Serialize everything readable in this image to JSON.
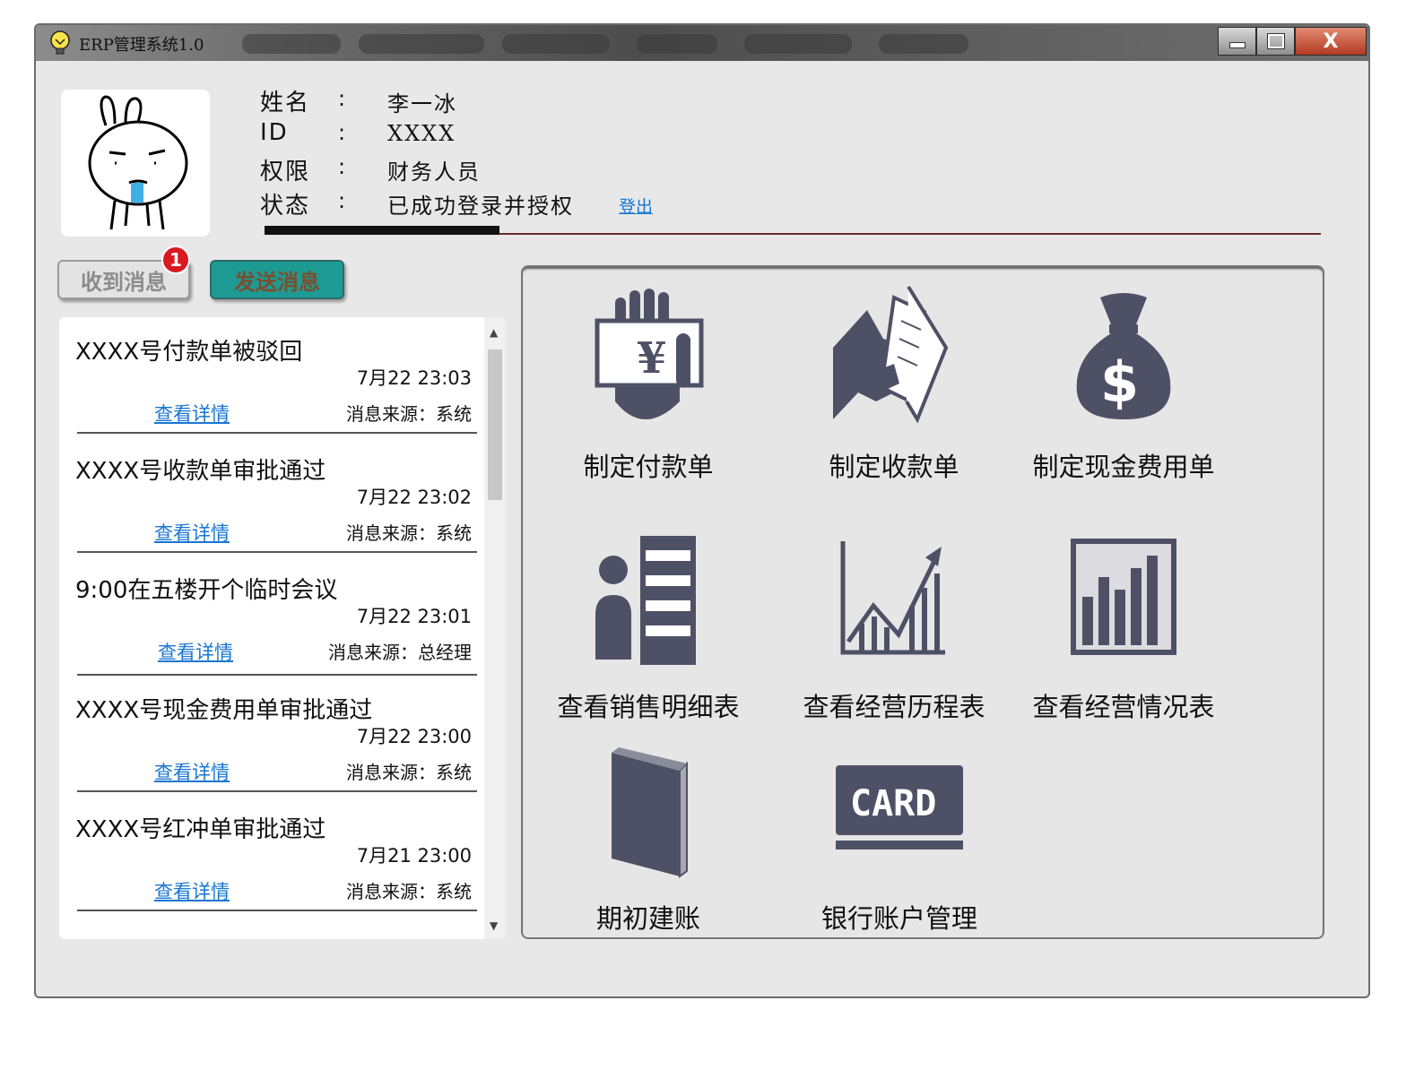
{
  "window": {
    "title": "ERP管理系统1.0",
    "close_label": "X"
  },
  "user": {
    "name_label": "姓名",
    "name": "李一冰",
    "id_label": "ID",
    "id": "XXXX",
    "role_label": "权限",
    "role": "财务人员",
    "status_label": "状态",
    "status": "已成功登录并授权",
    "logout": "登出",
    "colon": ":"
  },
  "buttons": {
    "received": "收到消息",
    "received_badge": "1",
    "send": "发送消息"
  },
  "messages": [
    {
      "title": "XXXX号付款单被驳回",
      "time": "7月22 23:03",
      "link": "查看详情",
      "source": "消息来源：系统"
    },
    {
      "title": "XXXX号收款单审批通过",
      "time": "7月22 23:02",
      "link": "查看详情",
      "source": "消息来源：系统"
    },
    {
      "title": "9:00在五楼开个临时会议",
      "time": "7月22 23:01",
      "link": "查看详情",
      "source": "消息来源：总经理"
    },
    {
      "title": "XXXX号现金费用单审批通过",
      "time": "7月22 23:00",
      "link": "查看详情",
      "source": "消息来源：系统"
    },
    {
      "title": "XXXX号红冲单审批通过",
      "time": "7月21 23:00",
      "link": "查看详情",
      "source": "消息来源：系统"
    }
  ],
  "functions": [
    {
      "label": "制定付款单",
      "icon": "hand-money-icon"
    },
    {
      "label": "制定收款单",
      "icon": "hand-receipt-icon"
    },
    {
      "label": "制定现金费用单",
      "icon": "money-bag-icon"
    },
    {
      "label": "查看销售明细表",
      "icon": "person-list-icon"
    },
    {
      "label": "查看经营历程表",
      "icon": "trend-chart-icon"
    },
    {
      "label": "查看经营情况表",
      "icon": "bar-chart-icon"
    },
    {
      "label": "期初建账",
      "icon": "book-icon"
    },
    {
      "label": "银行账户管理",
      "icon": "card-icon",
      "card_text": "CARD"
    }
  ],
  "colors": {
    "icon": "#4e5166",
    "link": "#1976d2",
    "send_button": "#1e9a94",
    "badge": "#d9191f"
  }
}
